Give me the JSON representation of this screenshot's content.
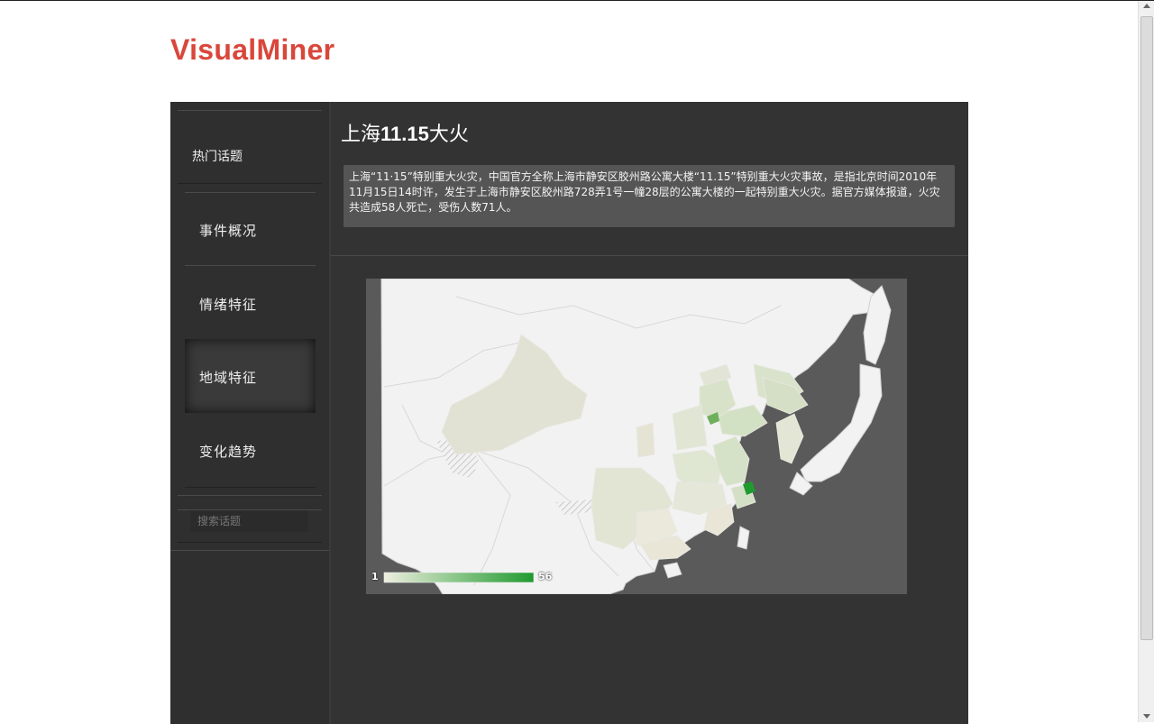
{
  "brand": {
    "name": "VisualMiner"
  },
  "sidebar": {
    "hot_topics": "热门话题",
    "items": [
      {
        "label": "事件概况",
        "active": false
      },
      {
        "label": "情绪特征",
        "active": false
      },
      {
        "label": "地域特征",
        "active": true
      },
      {
        "label": "变化趋势",
        "active": false
      }
    ],
    "search": {
      "placeholder": "搜索话题",
      "value": ""
    }
  },
  "main": {
    "title_prefix": "上海",
    "title_number": "11.15",
    "title_suffix": "大火",
    "description": "上海“11·15”特别重大火灾，中国官方全称上海市静安区胶州路公寓大楼“11.15”特别重大火灾事故，是指北京时间2010年11月15日14时许，发生于上海市静安区胶州路728弄1号一幢28层的公寓大楼的一起特别重大火灾。据官方媒体报道，火灾共造成58人死亡，受伤人数71人。"
  },
  "map": {
    "legend_min": "1",
    "legend_max": "56",
    "colors": {
      "sea": "#5a5a5a",
      "land": "#f2f2f2",
      "low": "#e6e4d6",
      "mid": "#c9dcbc",
      "high": "#1f9a2f",
      "border": "#d4d4d4"
    }
  }
}
